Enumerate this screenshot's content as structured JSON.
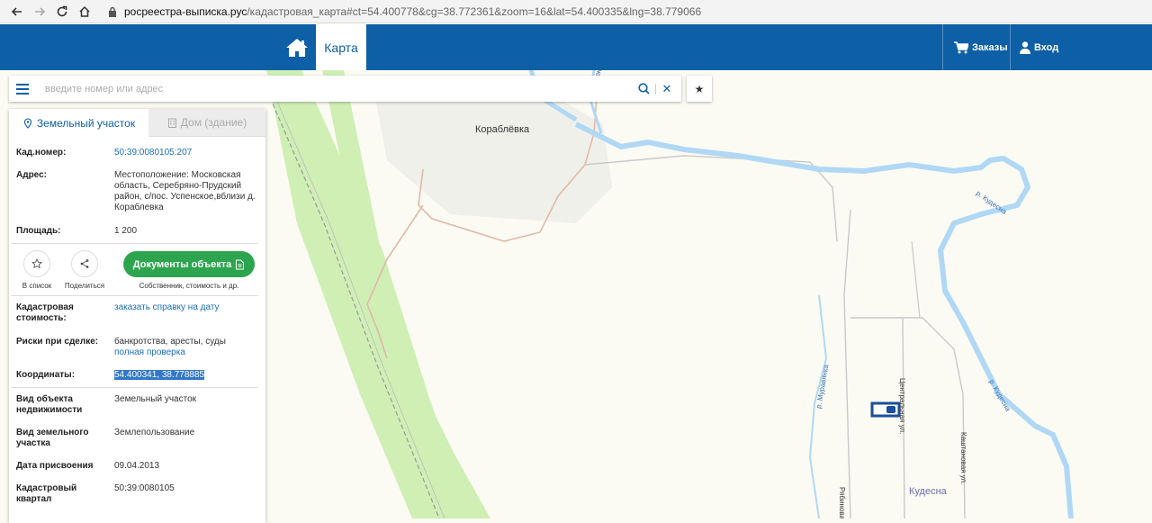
{
  "browser": {
    "url_domain": "росреестра-выписка.рус",
    "url_path": "/кадастровая_карта#ct=54.400778&cg=38.772361&zoom=16&lat=54.400335&lng=38.779066"
  },
  "header": {
    "map_tab": "Карта",
    "orders": "Заказы",
    "login": "Вход",
    "color": "#0d5fa6"
  },
  "search": {
    "placeholder": "введите номер или адрес",
    "clear": "✕",
    "favorite": "★"
  },
  "panel": {
    "tabs": [
      "Земельный участок",
      "Дом (здание)"
    ],
    "cad_number": {
      "label": "Кад.номер:",
      "value": "50:39:0080105:207"
    },
    "address": {
      "label": "Адрес:",
      "value": "Местоположение: Московская область, Серебряно-Прудский район, с/пос. Успенское,вблизи д. Кораблевка"
    },
    "area": {
      "label": "Площадь:",
      "value": "1 200"
    },
    "actions": {
      "add_to_list": "В список",
      "share": "Поделиться",
      "documents": "Документы объекта",
      "documents_sub": "Собственник, стоимость и др."
    },
    "cad_cost": {
      "label": "Кадастровая стоимость:",
      "value": "заказать справку на дату"
    },
    "risks": {
      "label": "Риски при сделке:",
      "value": "банкротства, аресты, суды",
      "link": "полная проверка"
    },
    "coords": {
      "label": "Координаты:",
      "value": "54.400341, 38.778885"
    },
    "object_type": {
      "label": "Вид объекта недвижимости",
      "value": "Земельный участок"
    },
    "land_type": {
      "label": "Вид земельного участка",
      "value": "Землепользование"
    },
    "assign_date": {
      "label": "Дата присвоения",
      "value": "09.04.2013"
    },
    "cad_quarter": {
      "label": "Кадастровый квартал",
      "value": "50:39:0080105"
    }
  },
  "map": {
    "labels": {
      "village1": "Кораблёвка",
      "village2": "Кудесна",
      "street1": "Рябиновая ул.",
      "street2": "Центральная ул.",
      "street3": "Каштановая ул.",
      "river1": "р. Кудесна",
      "river2": "р. Кудесна",
      "river3": "р. Кудесна",
      "river4": "р. Муравянка"
    },
    "water_color": "#b0d8f5",
    "forest_color": "#cfefb5"
  }
}
